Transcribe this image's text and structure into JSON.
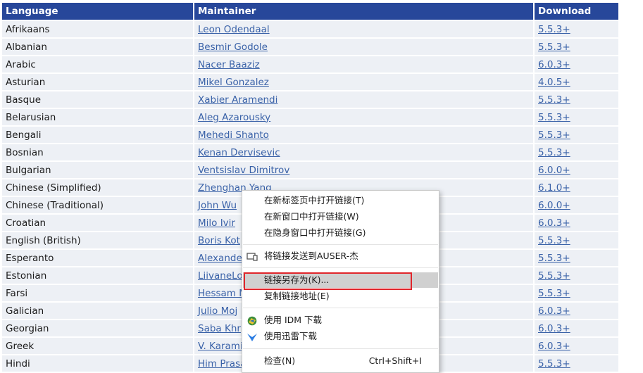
{
  "table": {
    "headers": [
      "Language",
      "Maintainer",
      "Download"
    ],
    "rows": [
      {
        "language": "Afrikaans",
        "maintainer": "Leon Odendaal",
        "download": "5.5.3+"
      },
      {
        "language": "Albanian",
        "maintainer": "Besmir Godole",
        "download": "5.5.3+"
      },
      {
        "language": "Arabic",
        "maintainer": "Nacer Baaziz",
        "download": "6.0.3+"
      },
      {
        "language": "Asturian",
        "maintainer": "Mikel Gonzalez",
        "download": "4.0.5+"
      },
      {
        "language": "Basque",
        "maintainer": "Xabier Aramendi",
        "download": "5.5.3+"
      },
      {
        "language": "Belarusian",
        "maintainer": "Aleg Azarousky",
        "download": "5.5.3+"
      },
      {
        "language": "Bengali",
        "maintainer": "Mehedi Shanto",
        "download": "5.5.3+"
      },
      {
        "language": "Bosnian",
        "maintainer": "Kenan Dervisevic",
        "download": "5.5.3+"
      },
      {
        "language": "Bulgarian",
        "maintainer": "Ventsislav Dimitrov",
        "download": "6.0.0+"
      },
      {
        "language": "Chinese (Simplified)",
        "maintainer": "Zhenghan Yang",
        "download": "6.1.0+"
      },
      {
        "language": "Chinese (Traditional)",
        "maintainer": "John Wu",
        "download": "6.0.0+"
      },
      {
        "language": "Croatian",
        "maintainer": "Milo Ivir",
        "download": "6.0.3+"
      },
      {
        "language": "English (British)",
        "maintainer": "Boris Kot",
        "download": "5.5.3+"
      },
      {
        "language": "Esperanto",
        "maintainer": "Alexande",
        "download": "5.5.3+"
      },
      {
        "language": "Estonian",
        "maintainer": "LiivaneLo",
        "download": "5.5.3+"
      },
      {
        "language": "Farsi",
        "maintainer": "Hessam M",
        "download": "5.5.3+"
      },
      {
        "language": "Galician",
        "maintainer": "Julio Moj",
        "download": "6.0.3+"
      },
      {
        "language": "Georgian",
        "maintainer": "Saba Khr",
        "download": "6.0.3+"
      },
      {
        "language": "Greek",
        "maintainer": "V. Karami",
        "download": "6.0.3+"
      },
      {
        "language": "Hindi",
        "maintainer": "Him Prasa",
        "download": "5.5.3+"
      }
    ]
  },
  "context_menu": {
    "open_new_tab": "在新标签页中打开链接(T)",
    "open_new_window": "在新窗口中打开链接(W)",
    "open_incognito": "在隐身窗口中打开链接(G)",
    "send_to_device": "将链接发送到AUSER-杰",
    "save_link_as": "链接另存为(K)...",
    "copy_link": "复制链接地址(E)",
    "download_idm": "使用 IDM 下载",
    "download_xunlei": "使用迅雷下载",
    "inspect": "检查(N)",
    "inspect_shortcut": "Ctrl+Shift+I"
  },
  "icons": {
    "send_to_device": "device-icon",
    "download_idm": "idm-icon",
    "download_xunlei": "xunlei-icon"
  },
  "colors": {
    "header_bg": "#27479a",
    "row_bg": "#edf0f5",
    "link": "#3a62a8",
    "highlight_border": "#e0252b"
  }
}
